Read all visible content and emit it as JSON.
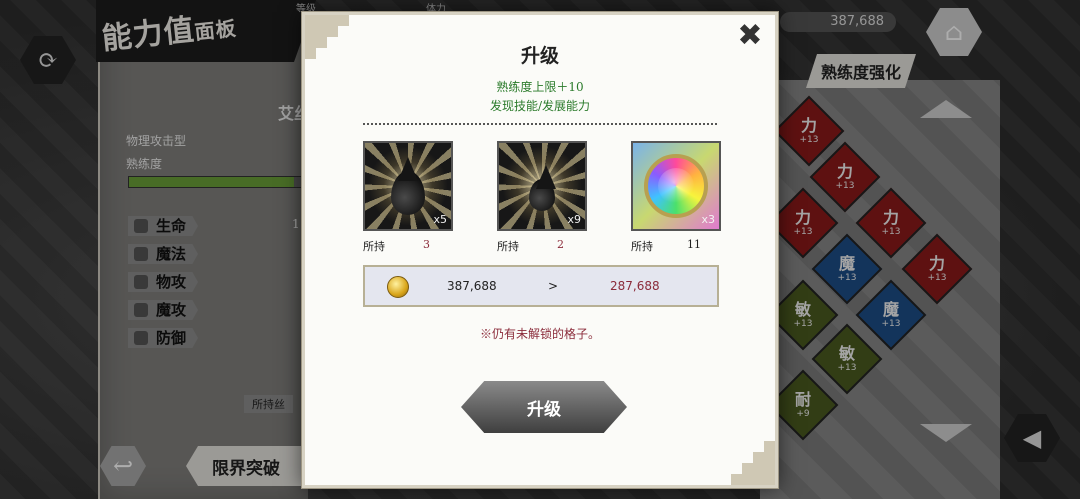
{
  "background": {
    "panel_title_main": "能力值",
    "panel_title_sub": "面板",
    "top_label_level": "等级",
    "top_label_stamina": "体力",
    "top_money": "387,688",
    "character_name": "艾丝",
    "character_type": "物理攻击型",
    "proficiency_label": "熟练度",
    "proficiency_progress": 0.95,
    "stats": [
      {
        "label": "生命",
        "icon": "heart-icon",
        "value": "1"
      },
      {
        "label": "魔法",
        "icon": "magic-icon",
        "value": ""
      },
      {
        "label": "物攻",
        "icon": "sword-icon",
        "value": ""
      },
      {
        "label": "魔攻",
        "icon": "staff-icon",
        "value": ""
      },
      {
        "label": "防御",
        "icon": "shield-icon",
        "value": ""
      }
    ],
    "owned_label_left": "所持丝",
    "proficiency_boost_button": "熟练度强化",
    "limit_break_button": "限界突破",
    "board_tiles": [
      {
        "label": "力",
        "bonus": "+13",
        "color": "red"
      },
      {
        "label": "力",
        "bonus": "+13",
        "color": "red"
      },
      {
        "label": "力",
        "bonus": "+13",
        "color": "red"
      },
      {
        "label": "力",
        "bonus": "+13",
        "color": "red"
      },
      {
        "label": "力",
        "bonus": "+13",
        "color": "red"
      },
      {
        "label": "魔",
        "bonus": "+13",
        "color": "blue"
      },
      {
        "label": "魔",
        "bonus": "+13",
        "color": "blue"
      },
      {
        "label": "敏",
        "bonus": "+13",
        "color": "green"
      },
      {
        "label": "敏",
        "bonus": "+13",
        "color": "green"
      },
      {
        "label": "耐",
        "bonus": "+9",
        "color": "green"
      }
    ]
  },
  "dialog": {
    "title": "升级",
    "subtitle_line1": "熟练度上限＋10",
    "subtitle_line2": "发现技能/发展能力",
    "close_symbol": "✖",
    "items": [
      {
        "name_icon": "black-drop-large-icon",
        "qty": "x5",
        "owned_label": "所持",
        "owned": "3"
      },
      {
        "name_icon": "black-drop-small-icon",
        "qty": "x9",
        "owned_label": "所持",
        "owned": "2"
      },
      {
        "name_icon": "rainbow-orb-icon",
        "qty": "x3",
        "owned_label": "所持",
        "owned": "11"
      }
    ],
    "money_current": "387,688",
    "money_arrow": ">",
    "money_after": "287,688",
    "warning": "※仍有未解锁的格子。",
    "confirm_button": "升级"
  }
}
